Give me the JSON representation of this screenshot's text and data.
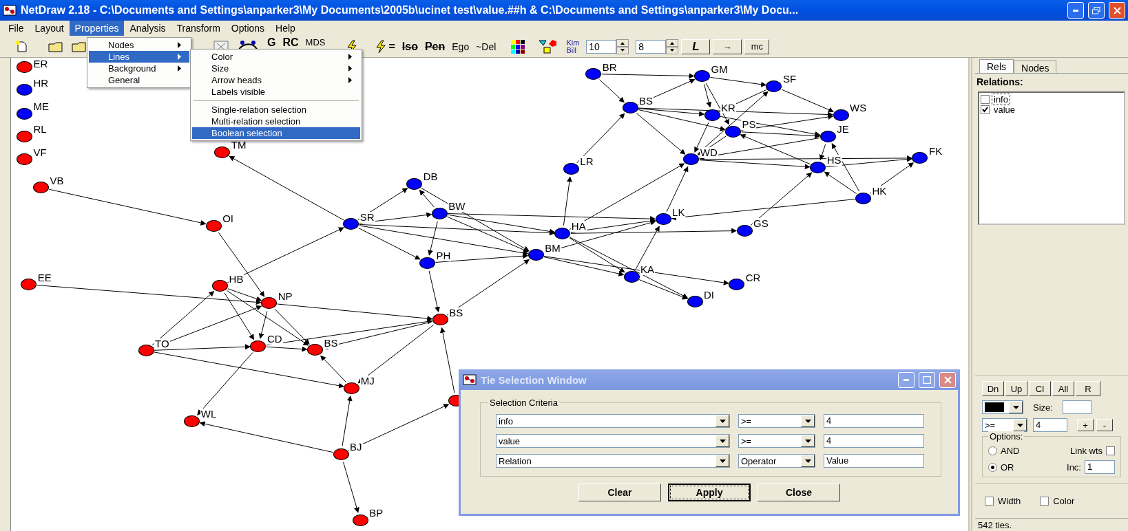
{
  "window": {
    "title": "NetDraw 2.18 - C:\\Documents and Settings\\anparker3\\My Documents\\2005b\\ucinet test\\value.##h & C:\\Documents and Settings\\anparker3\\My Docu..."
  },
  "menu": [
    {
      "label": "File",
      "selected": false
    },
    {
      "label": "Layout",
      "selected": false
    },
    {
      "label": "Properties",
      "selected": true
    },
    {
      "label": "Analysis",
      "selected": false
    },
    {
      "label": "Transform",
      "selected": false
    },
    {
      "label": "Options",
      "selected": false
    },
    {
      "label": "Help",
      "selected": false
    }
  ],
  "properties_menu": [
    {
      "label": "Nodes",
      "submenu": true,
      "selected": false
    },
    {
      "label": "Lines",
      "submenu": true,
      "selected": true
    },
    {
      "label": "Background",
      "submenu": true,
      "selected": false
    },
    {
      "label": "General",
      "submenu": false,
      "selected": false
    }
  ],
  "lines_submenu": [
    {
      "kind": "item",
      "label": "Color",
      "submenu": true,
      "selected": false
    },
    {
      "kind": "item",
      "label": "Size",
      "submenu": true,
      "selected": false
    },
    {
      "kind": "item",
      "label": "Arrow heads",
      "submenu": true,
      "selected": false
    },
    {
      "kind": "item",
      "label": "Labels visible",
      "submenu": false,
      "selected": false
    },
    {
      "kind": "separator"
    },
    {
      "kind": "item",
      "label": "Single-relation selection",
      "submenu": false,
      "selected": false
    },
    {
      "kind": "item",
      "label": "Multi-relation selection",
      "submenu": false,
      "selected": false
    },
    {
      "kind": "item",
      "label": "Boolean selection",
      "submenu": false,
      "selected": true
    }
  ],
  "toolbar": {
    "labels_a": [
      {
        "label": "G",
        "struck": false
      },
      {
        "label": "RC",
        "struck": false
      },
      {
        "label": "MDS",
        "struck": false
      }
    ],
    "equals": "=",
    "labels_b": [
      {
        "label": "Iso",
        "struck": true
      },
      {
        "label": "Pen",
        "struck": true
      },
      {
        "label": "Ego",
        "struck": false
      },
      {
        "label": "~Del",
        "struck": false
      }
    ],
    "kim": "Kim",
    "bill": "Bill",
    "spinners": [
      "10",
      "8"
    ],
    "buttons": [
      "L",
      "→",
      "mc"
    ]
  },
  "network": {
    "nodes": [
      {
        "label": "ER",
        "color": "#ff0000"
      },
      {
        "label": "HR",
        "color": "#0000ff"
      },
      {
        "label": "ME",
        "color": "#0000ff"
      },
      {
        "label": "RL",
        "color": "#ff0000"
      },
      {
        "label": "VF",
        "color": "#ff0000"
      },
      {
        "label": "TM",
        "color": "#ff0000"
      },
      {
        "label": "VB",
        "color": "#ff0000"
      },
      {
        "label": "OI",
        "color": "#ff0000"
      },
      {
        "label": "SR",
        "color": "#0000ff"
      },
      {
        "label": "DB",
        "color": "#0000ff"
      },
      {
        "label": "BW",
        "color": "#0000ff"
      },
      {
        "label": "PH",
        "color": "#0000ff"
      },
      {
        "label": "HA",
        "color": "#0000ff"
      },
      {
        "label": "BM",
        "color": "#0000ff"
      },
      {
        "label": "LK",
        "color": "#0000ff"
      },
      {
        "label": "GS",
        "color": "#0000ff"
      },
      {
        "label": "KA",
        "color": "#0000ff"
      },
      {
        "label": "CR",
        "color": "#0000ff"
      },
      {
        "label": "DI",
        "color": "#0000ff"
      },
      {
        "label": "EE",
        "color": "#ff0000"
      },
      {
        "label": "HB",
        "color": "#ff0000"
      },
      {
        "label": "NP",
        "color": "#ff0000"
      },
      {
        "label": "BS",
        "color": "#ff0000"
      },
      {
        "label": "TO",
        "color": "#ff0000"
      },
      {
        "label": "CD",
        "color": "#ff0000"
      },
      {
        "label": "BS",
        "color": "#ff0000"
      },
      {
        "label": "MJ",
        "color": "#ff0000"
      },
      {
        "label": "WL",
        "color": "#ff0000"
      },
      {
        "label": "BJ",
        "color": "#ff0000"
      },
      {
        "label": "BP",
        "color": "#ff0000"
      },
      {
        "color": "#ff0000"
      },
      {
        "label": "BR",
        "color": "#0000ff"
      },
      {
        "label": "GM",
        "color": "#0000ff"
      },
      {
        "label": "SF",
        "color": "#0000ff"
      },
      {
        "label": "BS",
        "color": "#0000ff"
      },
      {
        "label": "KR",
        "color": "#0000ff"
      },
      {
        "label": "WS",
        "color": "#0000ff"
      },
      {
        "label": "PS",
        "color": "#0000ff"
      },
      {
        "label": "JE",
        "color": "#0000ff"
      },
      {
        "label": "WD",
        "color": "#0000ff"
      },
      {
        "label": "LR",
        "color": "#0000ff"
      },
      {
        "label": "HS",
        "color": "#0000ff"
      },
      {
        "label": "FK",
        "color": "#0000ff"
      },
      {
        "label": "HK",
        "color": "#0000ff"
      }
    ]
  },
  "side_panel": {
    "tabs": [
      {
        "label": "Rels",
        "selected": true
      },
      {
        "label": "Nodes",
        "selected": false
      }
    ],
    "heading": "Relations:",
    "relations": [
      {
        "label": "info",
        "checked": false,
        "focused": true
      },
      {
        "label": "value",
        "checked": true,
        "focused": false
      }
    ],
    "nav_buttons": [
      "Dn",
      "Up",
      "Cl",
      "All",
      "R"
    ],
    "size_label": "Size:",
    "operator": ">=",
    "threshold": "4",
    "step_buttons": [
      "+",
      "-"
    ],
    "options": {
      "title": "Options:",
      "modes": [
        {
          "label": "AND",
          "selected": false
        },
        {
          "label": "OR",
          "selected": true
        }
      ],
      "link_wts": {
        "label": "Link wts",
        "checked": false
      },
      "inc": {
        "label": "Inc:",
        "value": "1"
      }
    },
    "scale": [
      {
        "label": "Width",
        "checked": false
      },
      {
        "label": "Color",
        "checked": false
      }
    ],
    "status": "542 ties."
  },
  "dialog": {
    "title": "Tie Selection Window",
    "group": "Selection Criteria",
    "criteria": [
      {
        "relation": "info",
        "operator": ">=",
        "value": "4"
      },
      {
        "relation": "value",
        "operator": ">=",
        "value": "4"
      },
      {
        "relation": "Relation",
        "operator": "Operator",
        "value": "Value"
      }
    ],
    "buttons": [
      {
        "label": "Clear",
        "focused": false
      },
      {
        "label": "Apply",
        "focused": true
      },
      {
        "label": "Close",
        "focused": false
      }
    ]
  }
}
